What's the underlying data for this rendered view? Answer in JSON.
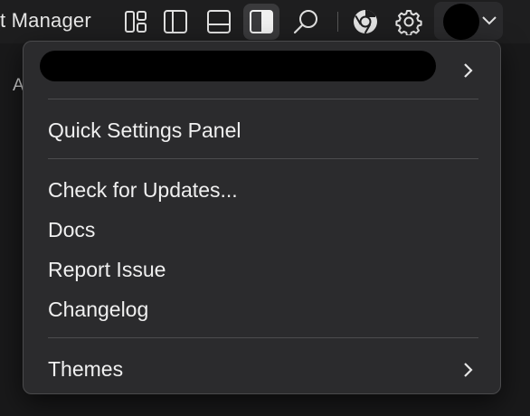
{
  "titlebar": {
    "title": "t Manager",
    "buttons": [
      {
        "name": "layout-grid",
        "active": false
      },
      {
        "name": "sidebar-left",
        "active": false
      },
      {
        "name": "panel-bottom",
        "active": false
      },
      {
        "name": "sidebar-right",
        "active": true
      },
      {
        "name": "search",
        "active": false
      },
      {
        "name": "chrome",
        "active": false
      },
      {
        "name": "settings",
        "active": false
      }
    ]
  },
  "background": {
    "partial_letter": "A"
  },
  "menu": {
    "items": [
      {
        "label": "Quick Settings Panel"
      },
      {
        "label": "Check for Updates..."
      },
      {
        "label": "Docs"
      },
      {
        "label": "Report Issue"
      },
      {
        "label": "Changelog"
      },
      {
        "label": "Themes"
      }
    ]
  },
  "colors": {
    "menu_bg": "#2b2b2d",
    "text": "#f0f0f0",
    "active_button": "#3a3a3c"
  }
}
